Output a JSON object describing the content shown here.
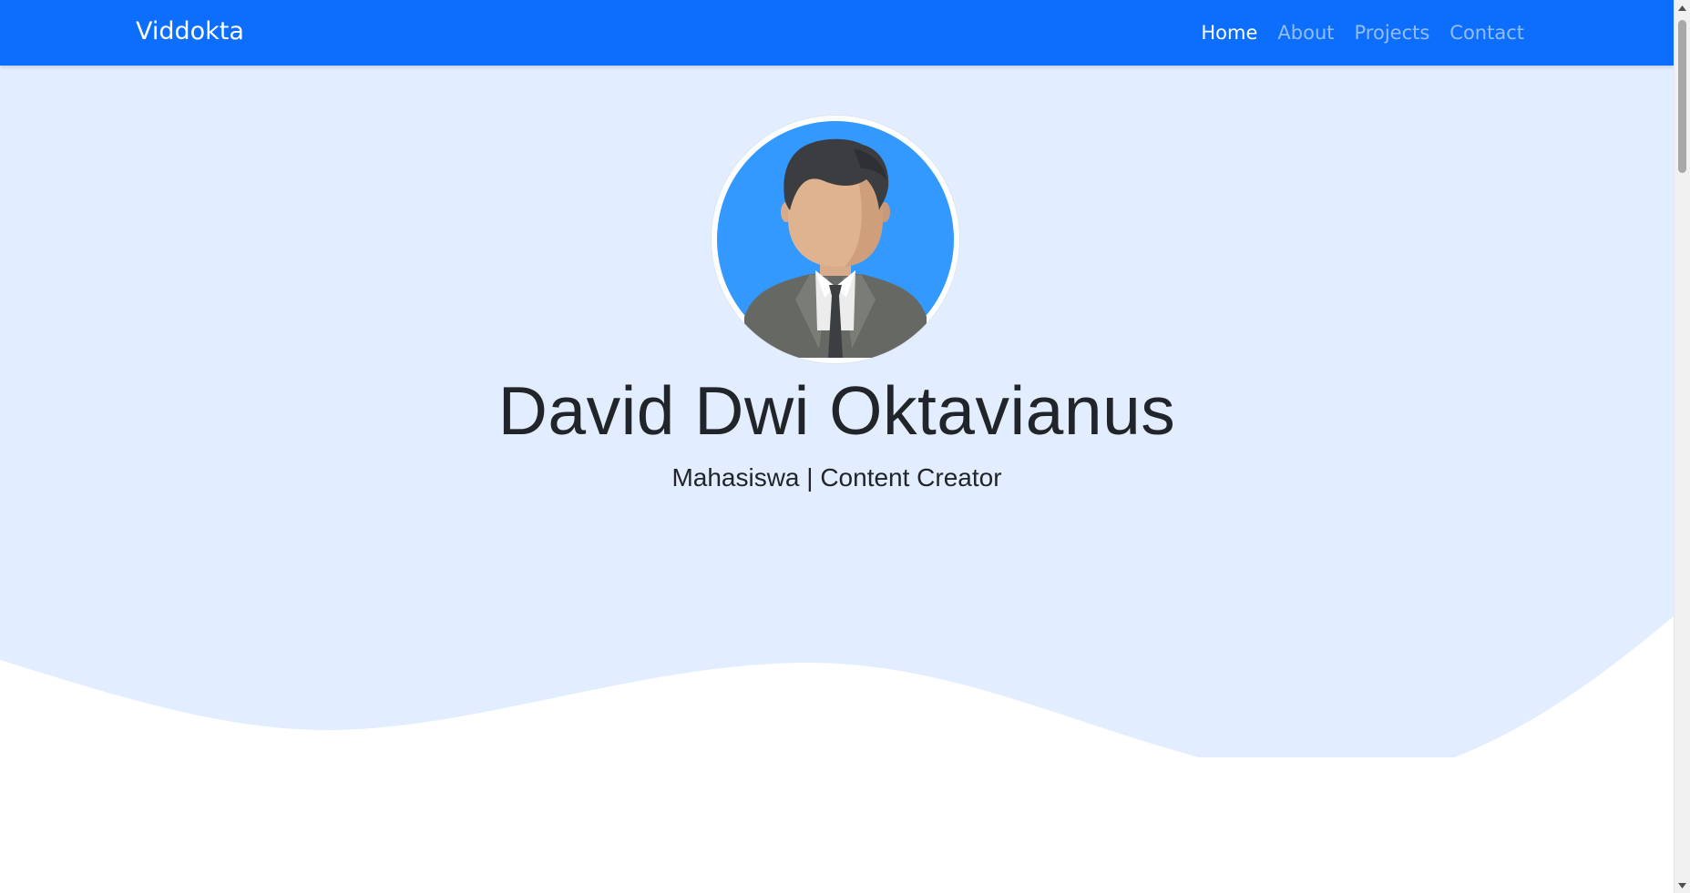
{
  "navbar": {
    "brand": "Viddokta",
    "links": [
      {
        "label": "Home",
        "active": true
      },
      {
        "label": "About",
        "active": false
      },
      {
        "label": "Projects",
        "active": false
      },
      {
        "label": "Contact",
        "active": false
      }
    ]
  },
  "hero": {
    "avatar_icon": "businessman-avatar-icon",
    "name": "David Dwi Oktavianus",
    "subtitle": "Mahasiswa | Content Creator"
  },
  "colors": {
    "navbar_bg": "#0d6efd",
    "hero_bg": "#e2edff",
    "avatar_bg": "#3399ff",
    "text": "#212529"
  }
}
